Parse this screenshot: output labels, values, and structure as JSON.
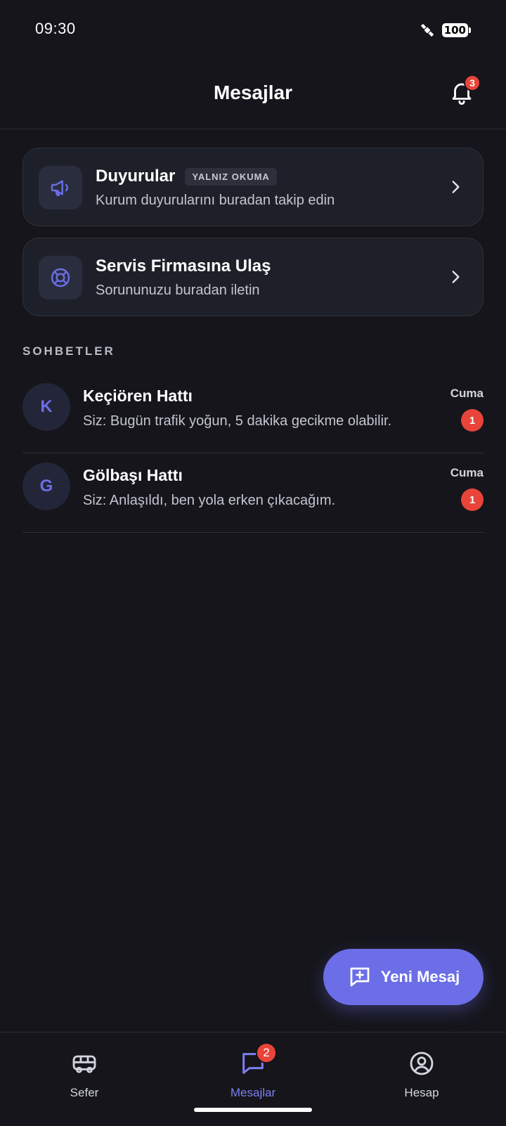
{
  "status_bar": {
    "time": "09:30",
    "battery": "100"
  },
  "header": {
    "title": "Mesajlar",
    "notification_count": "3"
  },
  "cards": [
    {
      "title": "Duyurular",
      "tag": "YALNIZ OKUMA",
      "subtitle": "Kurum duyurularını buradan takip edin",
      "icon": "megaphone-icon"
    },
    {
      "title": "Servis Firmasına Ulaş",
      "subtitle": "Sorununuzu buradan iletin",
      "icon": "lifebuoy-icon"
    }
  ],
  "chats_section": {
    "header": "SOHBETLER"
  },
  "chats": [
    {
      "initial": "K",
      "name": "Keçiören Hattı",
      "preview": "Siz: Bugün trafik yoğun, 5 dakika gecikme olabilir.",
      "time": "Cuma",
      "unread": "1"
    },
    {
      "initial": "G",
      "name": "Gölbaşı Hattı",
      "preview": "Siz: Anlaşıldı, ben yola erken çıkacağım.",
      "time": "Cuma",
      "unread": "1"
    }
  ],
  "fab": {
    "label": "Yeni Mesaj",
    "icon": "new-message-icon"
  },
  "tabs": [
    {
      "label": "Sefer",
      "icon": "bus-icon"
    },
    {
      "label": "Mesajlar",
      "icon": "chat-icon",
      "badge": "2",
      "active": true
    },
    {
      "label": "Hesap",
      "icon": "user-circle-icon"
    }
  ],
  "colors": {
    "accent": "#6b6ee6",
    "badge": "#e8443a",
    "background": "#15151b",
    "card": "#1e2029"
  }
}
